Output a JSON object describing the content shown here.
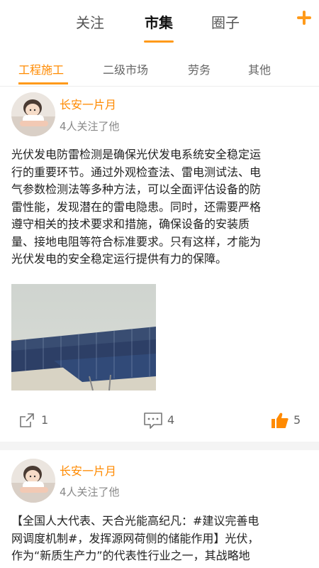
{
  "top_nav": {
    "tabs": [
      {
        "label": "关注"
      },
      {
        "label": "市集"
      },
      {
        "label": "圈子"
      }
    ],
    "plus_icon": "plus-icon"
  },
  "sub_nav": {
    "tabs": [
      {
        "label": "工程施工"
      },
      {
        "label": "二级市场"
      },
      {
        "label": "劳务"
      },
      {
        "label": "其他"
      }
    ]
  },
  "accent_color": "#ff8a00",
  "posts": [
    {
      "username": "长安一片月",
      "followers": "4人关注了他",
      "text_lines": [
        "光伏发电防雷检测是确保光伏发电系统安全稳定运",
        "行的重要环节。通过外观检查法、雷电测试法、电",
        "气参数检测法等多种方法，可以全面评估设备的防",
        "雷性能，发现潜在的雷电隐患。同时，还需要严格",
        "遵守相关的技术要求和措施，确保设备的安装质",
        "量、接地电阻等符合标准要求。只有这样，才能为",
        "光伏发电的安全稳定运行提供有力的保障。"
      ],
      "share_count": "1",
      "comment_count": "4",
      "like_count": "5"
    },
    {
      "username": "长安一片月",
      "followers": "4人关注了他",
      "text_lines": [
        "【全国人大代表、天合光能高纪凡：#建议完善电",
        "网调度机制#，发挥源网荷侧的储能作用】光伏，",
        "作为“新质生产力”的代表性行业之一，其战略地"
      ]
    }
  ]
}
